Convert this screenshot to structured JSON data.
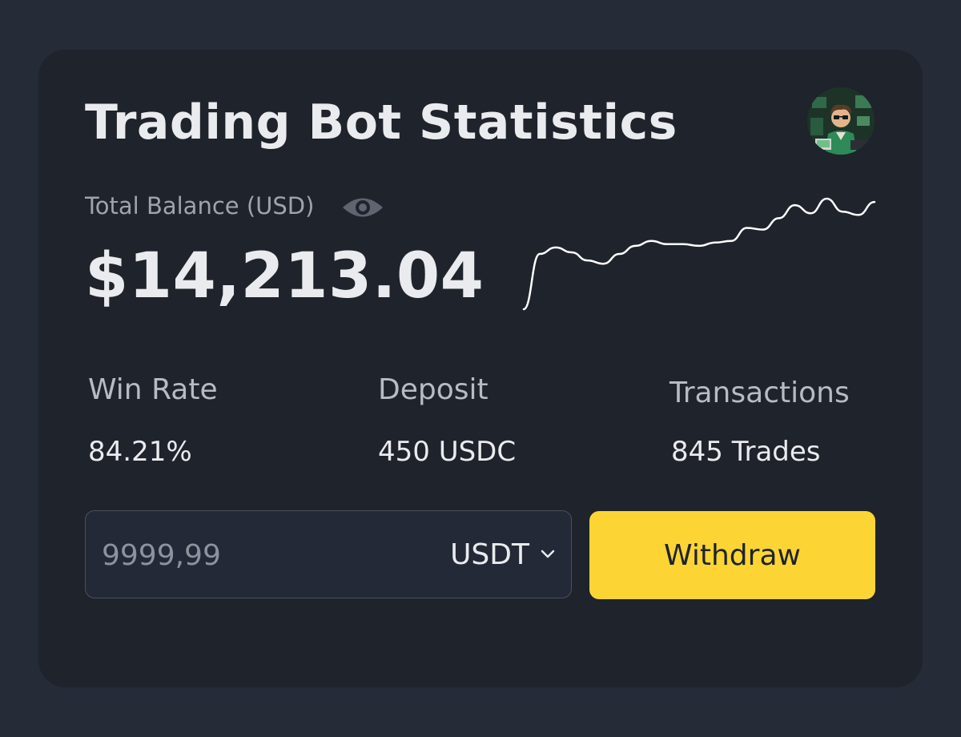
{
  "header": {
    "title": "Trading Bot Statistics"
  },
  "balance": {
    "label": "Total Balance (USD)",
    "value": "$14,213.04",
    "trend": [
      0,
      34,
      38,
      35,
      30,
      28,
      34,
      39,
      42,
      40,
      40,
      39,
      41,
      42,
      50,
      49,
      56,
      64,
      59,
      68,
      60,
      58,
      66
    ]
  },
  "stats": {
    "win_rate": {
      "label": "Win Rate",
      "value": "84.21%"
    },
    "deposit": {
      "label": "Deposit",
      "value": "450 USDC"
    },
    "transactions": {
      "label": "Transactions",
      "value": "845 Trades"
    }
  },
  "withdraw_form": {
    "amount_placeholder": "9999,99",
    "currency": "USDT",
    "button_label": "Withdraw"
  },
  "icons": {
    "visibility": "eye-icon",
    "dropdown": "chevron-down-icon"
  },
  "colors": {
    "background": "#252b37",
    "card": "#1f232b",
    "accent": "#fcd535",
    "text": "#eaebee",
    "muted": "#9ea3ad"
  }
}
